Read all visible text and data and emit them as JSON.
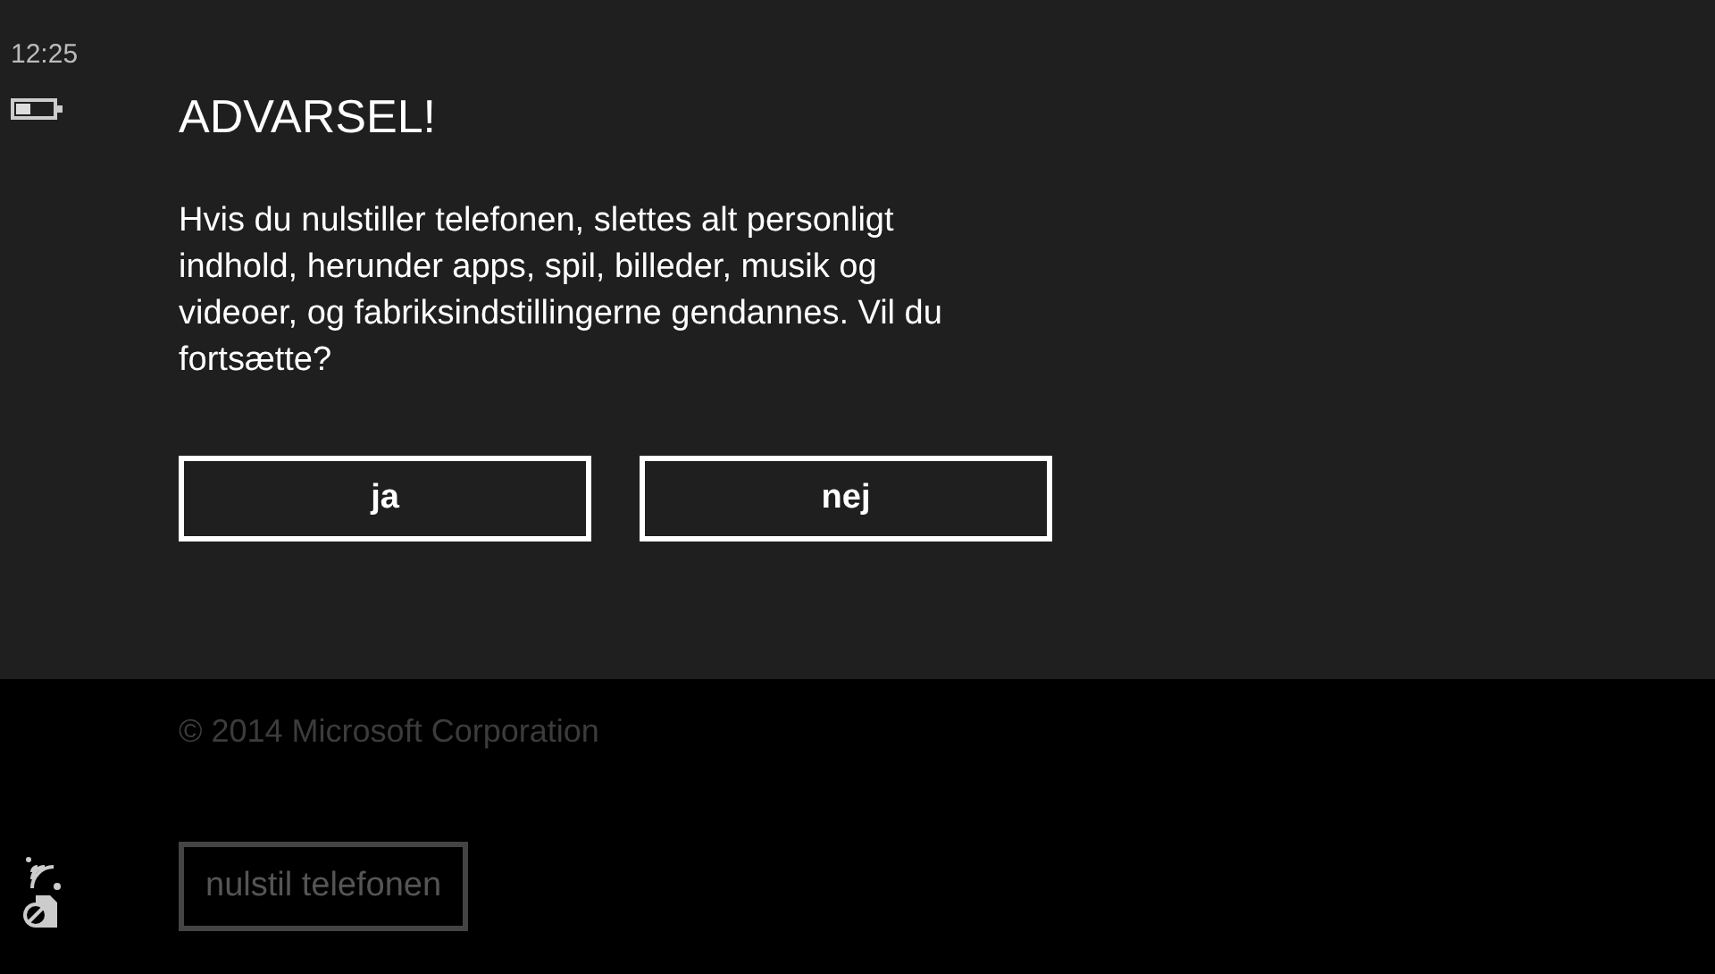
{
  "status_bar": {
    "time": "12:25"
  },
  "dialog": {
    "title": "ADVARSEL!",
    "message": "Hvis du nulstiller telefonen, slettes alt personligt indhold, herunder apps, spil, billeder, musik og videoer, og fabriksindstillingerne gendannes. Vil du fortsætte?",
    "buttons": [
      {
        "label": "ja"
      },
      {
        "label": "nej"
      }
    ]
  },
  "page": {
    "copyright": "© 2014 Microsoft Corporation",
    "reset_button": {
      "label": "nulstil telefonen",
      "disabled": true
    }
  }
}
